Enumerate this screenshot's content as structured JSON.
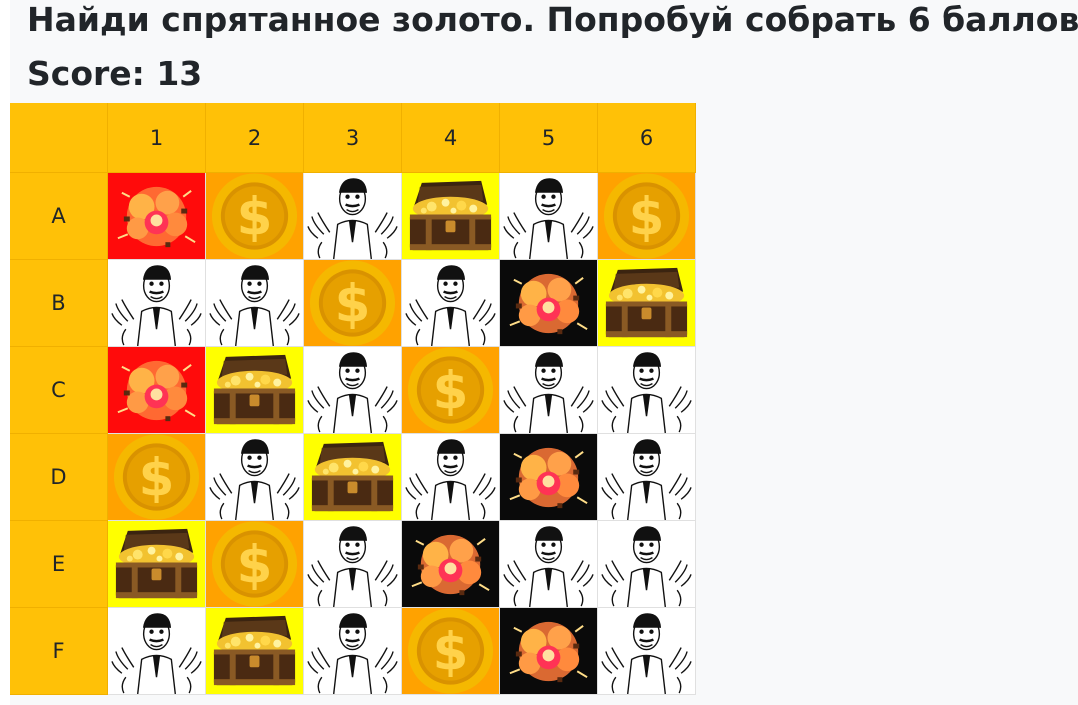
{
  "title": "Найди спрятанное золото. Попробуй собрать 6 баллов",
  "score_label": "Score: 13",
  "columns": [
    "1",
    "2",
    "3",
    "4",
    "5",
    "6"
  ],
  "rows": [
    {
      "label": "A",
      "cells": [
        "bomb-red",
        "coin",
        "man",
        "chest",
        "man",
        "coin"
      ]
    },
    {
      "label": "B",
      "cells": [
        "man",
        "man",
        "coin",
        "man",
        "bomb-black",
        "chest"
      ]
    },
    {
      "label": "C",
      "cells": [
        "bomb-red",
        "chest",
        "man",
        "coin",
        "man",
        "man"
      ]
    },
    {
      "label": "D",
      "cells": [
        "coin",
        "man",
        "chest",
        "man",
        "bomb-black",
        "man"
      ]
    },
    {
      "label": "E",
      "cells": [
        "chest",
        "coin",
        "man",
        "bomb-black",
        "man",
        "man"
      ]
    },
    {
      "label": "F",
      "cells": [
        "man",
        "chest",
        "man",
        "coin",
        "bomb-black",
        "man"
      ]
    }
  ],
  "tile_icons": {
    "coin": "dollar-coin-icon",
    "chest": "treasure-chest-icon",
    "man": "meme-man-icon",
    "bomb-red": "explosion-icon",
    "bomb-black": "explosion-icon"
  },
  "colors": {
    "header": "#ffc107",
    "coin_bg": "#ffa200",
    "chest_bg": "#ffff00",
    "bomb_red_bg": "#ff0b0b",
    "bomb_black_bg": "#0a0a0a"
  }
}
